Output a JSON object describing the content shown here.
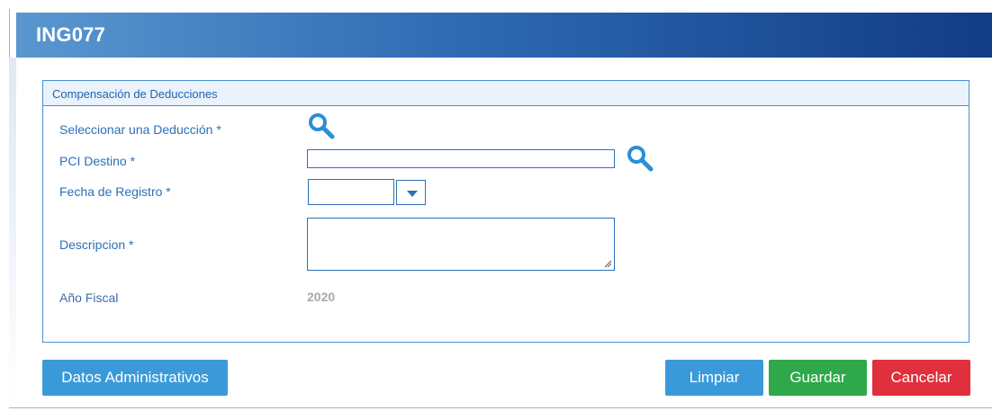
{
  "header": {
    "title": "ING077"
  },
  "section": {
    "title": "Compensación de Deducciones"
  },
  "form": {
    "deduccion": {
      "label": "Seleccionar una Deducción *",
      "icon": "search-icon"
    },
    "pci_destino": {
      "label": "PCI Destino *",
      "value": "",
      "icon": "search-icon"
    },
    "fecha_registro": {
      "label": "Fecha de Registro *",
      "value": "",
      "icon": "chevron-down-icon"
    },
    "descripcion": {
      "label": "Descripcion *",
      "value": ""
    },
    "anio_fiscal": {
      "label": "Año Fiscal",
      "value": "2020"
    }
  },
  "buttons": {
    "datos_administrativos": "Datos Administrativos",
    "limpiar": "Limpiar",
    "guardar": "Guardar",
    "cancelar": "Cancelar"
  },
  "colors": {
    "title_gradient_start": "#5a97d0",
    "title_gradient_end": "#123c85",
    "label": "#2d6fb8",
    "primary_button": "#3a9ad9",
    "save_button": "#2ea84a",
    "cancel_button": "#e0303d"
  }
}
